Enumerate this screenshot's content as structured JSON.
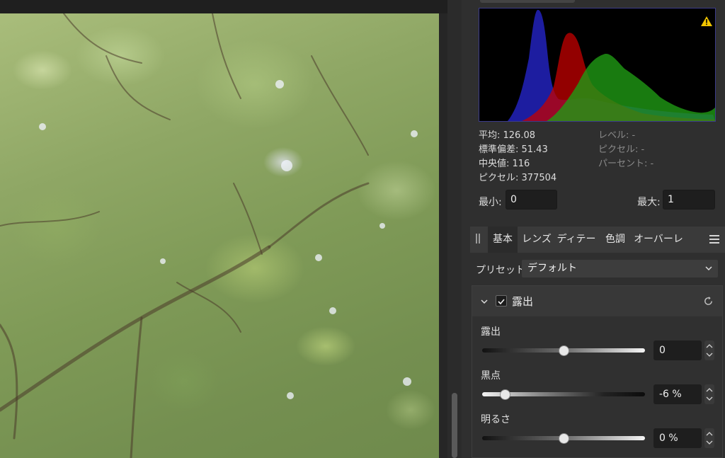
{
  "histogram": {
    "warning_icon": "warning-triangle-icon",
    "colors": {
      "blue": "#2525c8",
      "red": "#c40000",
      "green": "#1f9a14",
      "border": "#3b3b8a"
    }
  },
  "stats": {
    "mean": "平均: 126.08",
    "std_dev": "標準偏差: 51.43",
    "median": "中央値: 116",
    "pixels": "ピクセル: 377504",
    "level": "レベル: -",
    "pixel": "ピクセル: -",
    "percent": "パーセント: -"
  },
  "range": {
    "min_label": "最小:",
    "min_value": "0",
    "max_label": "最大:",
    "max_value": "1"
  },
  "tabs": [
    {
      "label": "基本",
      "active": true
    },
    {
      "label": "レンズ",
      "active": false
    },
    {
      "label": "ディテール",
      "active": false
    },
    {
      "label": "色調",
      "active": false
    },
    {
      "label": "オーバーレイ",
      "active": false
    }
  ],
  "preset": {
    "label": "プリセット:",
    "value": "デフォルト"
  },
  "exposure_section": {
    "title": "露出",
    "enabled": true,
    "fields": [
      {
        "label": "露出",
        "value": "0",
        "level": 0.5
      },
      {
        "label": "黒点",
        "value": "-6 %",
        "level": 0.14
      },
      {
        "label": "明るさ",
        "value": "0 %",
        "level": 0.5
      }
    ]
  }
}
